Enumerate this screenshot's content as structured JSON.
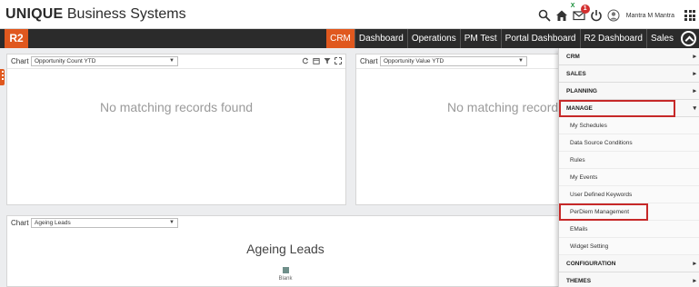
{
  "brand": {
    "strong": "UNIQUE",
    "rest": " Business Systems"
  },
  "header": {
    "mail_badge": "1",
    "excel_badge": "X",
    "user_name": "Mantra M Mantra"
  },
  "nav": {
    "logo": "R2",
    "items": [
      "CRM",
      "Dashboard",
      "Operations",
      "PM Test",
      "Portal Dashboard",
      "R2 Dashboard",
      "Sales"
    ],
    "active": "CRM"
  },
  "panels": {
    "opp_count": {
      "label": "Chart",
      "selected": "Opportunity Count YTD",
      "message": "No matching records found"
    },
    "opp_value": {
      "label": "Chart",
      "selected": "Opportunity Value YTD",
      "message": "No matching records found"
    },
    "ageing": {
      "label": "Chart",
      "selected": "Ageing Leads",
      "title": "Ageing Leads",
      "legend": "Blank"
    }
  },
  "menu": {
    "top_items": [
      "CRM",
      "SALES",
      "PLANNING",
      "MANAGE",
      "CONFIGURATION",
      "THEMES"
    ],
    "manage_items": [
      "My Schedules",
      "Data Source Conditions",
      "Rules",
      "My Events",
      "User Defined Keywords",
      "PerDiem Management",
      "EMails",
      "Widget Setting"
    ],
    "highlighted": [
      "MANAGE",
      "PerDiem Management"
    ]
  }
}
